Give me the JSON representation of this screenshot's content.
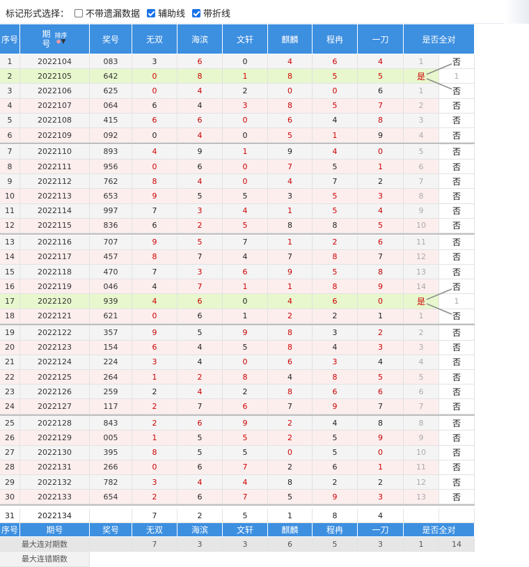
{
  "toolbar": {
    "label": "标记形式选择：",
    "options": [
      {
        "label": "不带遗漏数据",
        "checked": false
      },
      {
        "label": "辅助线",
        "checked": true
      },
      {
        "label": "带折线",
        "checked": true
      }
    ]
  },
  "columns": [
    "序号",
    "期号",
    "奖号",
    "无双",
    "海滨",
    "文轩",
    "麒麟",
    "程冉",
    "一刀",
    "是否全对"
  ],
  "header_period": {
    "line1": "期",
    "line2": "号",
    "sort_label": "排序"
  },
  "colors": {
    "header_bg": "#3d8fe0",
    "row_odd": "#f4f4f4",
    "row_even": "#fdeeee",
    "highlight_row": "#e8f7cd",
    "red": "#cc0000",
    "line": "#8c8c8c"
  },
  "rows": [
    {
      "seq": "1",
      "period": "2022104",
      "prize": "083",
      "p": [
        "3",
        "6",
        "0",
        "4",
        "6",
        "4"
      ],
      "c": [
        "b",
        "r",
        "b",
        "r",
        "r",
        "r"
      ],
      "mark": "1",
      "yes": false
    },
    {
      "seq": "2",
      "period": "2022105",
      "prize": "642",
      "p": [
        "0",
        "8",
        "1",
        "8",
        "5",
        "5"
      ],
      "c": [
        "r",
        "r",
        "r",
        "r",
        "r",
        "r"
      ],
      "mark": "1",
      "yes": true
    },
    {
      "seq": "3",
      "period": "2022106",
      "prize": "625",
      "p": [
        "0",
        "4",
        "2",
        "0",
        "0",
        "6"
      ],
      "c": [
        "r",
        "r",
        "b",
        "r",
        "r",
        "b"
      ],
      "mark": "1",
      "yes": false
    },
    {
      "seq": "4",
      "period": "2022107",
      "prize": "064",
      "p": [
        "6",
        "4",
        "3",
        "8",
        "5",
        "7"
      ],
      "c": [
        "b",
        "b",
        "r",
        "r",
        "r",
        "r"
      ],
      "mark": "2",
      "yes": false
    },
    {
      "seq": "5",
      "period": "2022108",
      "prize": "415",
      "p": [
        "6",
        "6",
        "0",
        "6",
        "4",
        "8"
      ],
      "c": [
        "r",
        "r",
        "r",
        "r",
        "b",
        "r"
      ],
      "mark": "3",
      "yes": false
    },
    {
      "seq": "6",
      "period": "2022109",
      "prize": "092",
      "p": [
        "0",
        "4",
        "0",
        "5",
        "1",
        "9"
      ],
      "c": [
        "b",
        "r",
        "b",
        "r",
        "r",
        "b"
      ],
      "mark": "4",
      "yes": false
    },
    {
      "seq": "7",
      "period": "2022110",
      "prize": "893",
      "p": [
        "4",
        "9",
        "1",
        "9",
        "4",
        "0"
      ],
      "c": [
        "r",
        "b",
        "r",
        "b",
        "r",
        "r"
      ],
      "mark": "5",
      "yes": false
    },
    {
      "seq": "8",
      "period": "2022111",
      "prize": "956",
      "p": [
        "0",
        "6",
        "0",
        "7",
        "5",
        "1"
      ],
      "c": [
        "r",
        "b",
        "r",
        "r",
        "b",
        "r"
      ],
      "mark": "6",
      "yes": false
    },
    {
      "seq": "9",
      "period": "2022112",
      "prize": "762",
      "p": [
        "8",
        "4",
        "0",
        "4",
        "7",
        "2"
      ],
      "c": [
        "r",
        "r",
        "r",
        "r",
        "b",
        "b"
      ],
      "mark": "7",
      "yes": false
    },
    {
      "seq": "10",
      "period": "2022113",
      "prize": "653",
      "p": [
        "9",
        "5",
        "5",
        "3",
        "5",
        "3"
      ],
      "c": [
        "r",
        "b",
        "b",
        "b",
        "r",
        "r"
      ],
      "mark": "8",
      "yes": false
    },
    {
      "seq": "11",
      "period": "2022114",
      "prize": "997",
      "p": [
        "7",
        "3",
        "4",
        "1",
        "5",
        "4"
      ],
      "c": [
        "b",
        "r",
        "r",
        "r",
        "r",
        "r"
      ],
      "mark": "9",
      "yes": false
    },
    {
      "seq": "12",
      "period": "2022115",
      "prize": "836",
      "p": [
        "6",
        "2",
        "5",
        "8",
        "8",
        "5"
      ],
      "c": [
        "b",
        "r",
        "r",
        "b",
        "b",
        "r"
      ],
      "mark": "10",
      "yes": false
    },
    {
      "seq": "13",
      "period": "2022116",
      "prize": "707",
      "p": [
        "9",
        "5",
        "7",
        "1",
        "2",
        "6"
      ],
      "c": [
        "r",
        "r",
        "b",
        "r",
        "r",
        "r"
      ],
      "mark": "11",
      "yes": false
    },
    {
      "seq": "14",
      "period": "2022117",
      "prize": "457",
      "p": [
        "8",
        "7",
        "4",
        "7",
        "8",
        "7"
      ],
      "c": [
        "r",
        "b",
        "b",
        "b",
        "r",
        "b"
      ],
      "mark": "12",
      "yes": false
    },
    {
      "seq": "15",
      "period": "2022118",
      "prize": "470",
      "p": [
        "7",
        "3",
        "6",
        "9",
        "5",
        "8"
      ],
      "c": [
        "b",
        "r",
        "r",
        "r",
        "r",
        "r"
      ],
      "mark": "13",
      "yes": false
    },
    {
      "seq": "16",
      "period": "2022119",
      "prize": "046",
      "p": [
        "4",
        "7",
        "1",
        "1",
        "8",
        "9"
      ],
      "c": [
        "b",
        "r",
        "r",
        "r",
        "r",
        "r"
      ],
      "mark": "14",
      "yes": false
    },
    {
      "seq": "17",
      "period": "2022120",
      "prize": "939",
      "p": [
        "4",
        "6",
        "0",
        "4",
        "6",
        "0"
      ],
      "c": [
        "r",
        "r",
        "b",
        "r",
        "r",
        "r"
      ],
      "mark": "1",
      "yes": true
    },
    {
      "seq": "18",
      "period": "2022121",
      "prize": "621",
      "p": [
        "0",
        "6",
        "1",
        "2",
        "2",
        "1"
      ],
      "c": [
        "r",
        "b",
        "b",
        "r",
        "b",
        "b"
      ],
      "mark": "1",
      "yes": false
    },
    {
      "seq": "19",
      "period": "2022122",
      "prize": "357",
      "p": [
        "9",
        "5",
        "9",
        "8",
        "3",
        "2"
      ],
      "c": [
        "r",
        "b",
        "r",
        "r",
        "b",
        "r"
      ],
      "mark": "2",
      "yes": false
    },
    {
      "seq": "20",
      "period": "2022123",
      "prize": "154",
      "p": [
        "6",
        "4",
        "5",
        "8",
        "4",
        "3"
      ],
      "c": [
        "r",
        "b",
        "b",
        "r",
        "b",
        "r"
      ],
      "mark": "3",
      "yes": false
    },
    {
      "seq": "21",
      "period": "2022124",
      "prize": "224",
      "p": [
        "3",
        "4",
        "0",
        "6",
        "3",
        "4"
      ],
      "c": [
        "r",
        "b",
        "r",
        "r",
        "r",
        "b"
      ],
      "mark": "4",
      "yes": false
    },
    {
      "seq": "22",
      "period": "2022125",
      "prize": "264",
      "p": [
        "1",
        "2",
        "8",
        "4",
        "8",
        "5"
      ],
      "c": [
        "r",
        "r",
        "r",
        "b",
        "r",
        "r"
      ],
      "mark": "5",
      "yes": false
    },
    {
      "seq": "23",
      "period": "2022126",
      "prize": "259",
      "p": [
        "2",
        "4",
        "2",
        "8",
        "6",
        "6"
      ],
      "c": [
        "b",
        "r",
        "b",
        "r",
        "r",
        "r"
      ],
      "mark": "6",
      "yes": false
    },
    {
      "seq": "24",
      "period": "2022127",
      "prize": "117",
      "p": [
        "2",
        "7",
        "6",
        "7",
        "9",
        "7"
      ],
      "c": [
        "r",
        "b",
        "r",
        "b",
        "r",
        "b"
      ],
      "mark": "7",
      "yes": false
    },
    {
      "seq": "25",
      "period": "2022128",
      "prize": "843",
      "p": [
        "2",
        "6",
        "9",
        "2",
        "4",
        "8"
      ],
      "c": [
        "r",
        "r",
        "r",
        "r",
        "b",
        "b"
      ],
      "mark": "8",
      "yes": false
    },
    {
      "seq": "26",
      "period": "2022129",
      "prize": "005",
      "p": [
        "1",
        "5",
        "5",
        "2",
        "5",
        "9"
      ],
      "c": [
        "r",
        "b",
        "r",
        "r",
        "b",
        "r"
      ],
      "mark": "9",
      "yes": false
    },
    {
      "seq": "27",
      "period": "2022130",
      "prize": "395",
      "p": [
        "8",
        "5",
        "5",
        "0",
        "5",
        "0"
      ],
      "c": [
        "r",
        "b",
        "b",
        "r",
        "b",
        "r"
      ],
      "mark": "10",
      "yes": false
    },
    {
      "seq": "28",
      "period": "2022131",
      "prize": "266",
      "p": [
        "0",
        "6",
        "7",
        "2",
        "6",
        "1"
      ],
      "c": [
        "r",
        "b",
        "r",
        "b",
        "b",
        "r"
      ],
      "mark": "11",
      "yes": false
    },
    {
      "seq": "29",
      "period": "2022132",
      "prize": "782",
      "p": [
        "3",
        "4",
        "4",
        "8",
        "2",
        "2"
      ],
      "c": [
        "r",
        "r",
        "r",
        "b",
        "b",
        "b"
      ],
      "mark": "12",
      "yes": false
    },
    {
      "seq": "30",
      "period": "2022133",
      "prize": "654",
      "p": [
        "2",
        "6",
        "7",
        "5",
        "9",
        "3"
      ],
      "c": [
        "r",
        "b",
        "r",
        "b",
        "r",
        "r"
      ],
      "mark": "13",
      "yes": false
    }
  ],
  "next_row": {
    "seq": "31",
    "period": "2022134",
    "p": [
      "7",
      "2",
      "5",
      "1",
      "8",
      "4"
    ]
  },
  "footer_header": [
    "序号",
    "期号",
    "奖号",
    "无双",
    "海滨",
    "文轩",
    "麒麟",
    "程冉",
    "一刀",
    "是否全对"
  ],
  "stats": {
    "label": "最大连对期数",
    "values": [
      "7",
      "3",
      "3",
      "6",
      "5",
      "3"
    ],
    "extra": [
      "1",
      "14"
    ]
  },
  "stats2": {
    "label": "最大连错期数"
  },
  "yes_text": "是",
  "no_text": "否"
}
